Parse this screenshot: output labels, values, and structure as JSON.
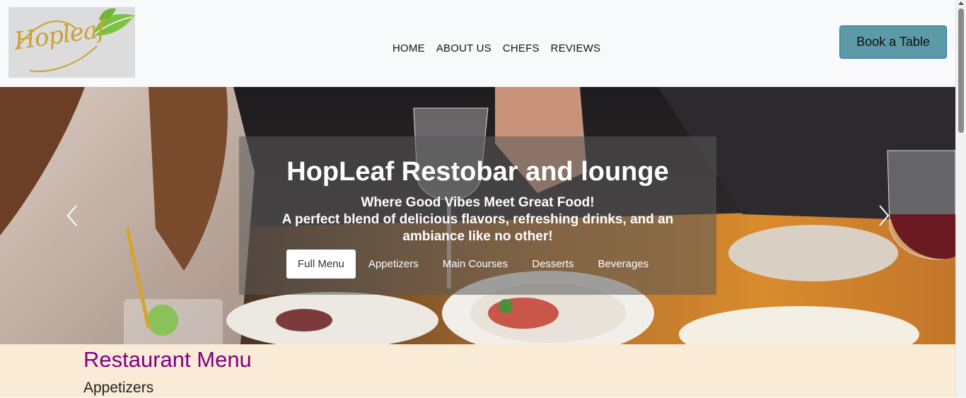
{
  "brand": {
    "logo_text": "Hopleaf"
  },
  "nav": {
    "links": [
      "HOME",
      "ABOUT US",
      "CHEFS",
      "REVIEWS"
    ],
    "cta_label": "Book a Table"
  },
  "hero": {
    "title": "HopLeaf Restobar and lounge",
    "subtitle_line1": "Where Good Vibes Meet Great Food!",
    "subtitle_line2": "A perfect blend of delicious flavors, refreshing drinks, and an ambiance like no other!",
    "menu_tabs": [
      "Full Menu",
      "Appetizers",
      "Main Courses",
      "Desserts",
      "Beverages"
    ],
    "active_tab": "Full Menu"
  },
  "menu_section": {
    "heading": "Restaurant Menu",
    "subheading": "Appetizers"
  },
  "colors": {
    "navbar_bg": "#f8f9fa",
    "cta_bg": "#5b9aa6",
    "cta_border": "#1f6fb2",
    "menu_section_bg": "#faebd7",
    "menu_heading": "#800080",
    "logo_gold": "#c9a136",
    "logo_leaf": "#7cc242"
  }
}
